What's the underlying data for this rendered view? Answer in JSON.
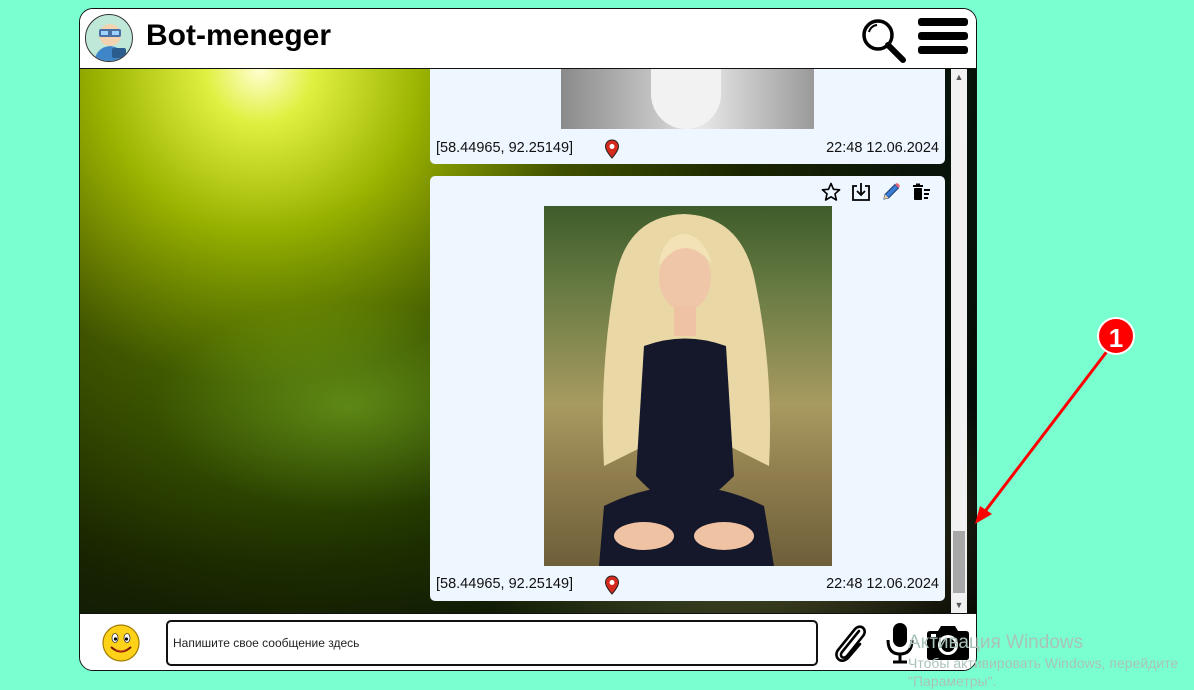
{
  "header": {
    "title": "Bot-meneger"
  },
  "messages": [
    {
      "coords": "[58.44965, 92.25149]",
      "time": "22:48 12.06.2024"
    },
    {
      "coords": "[58.44965, 92.25149]",
      "time": "22:48 12.06.2024"
    }
  ],
  "composer": {
    "placeholder": "Напишите свое сообщение здесь"
  },
  "watermark": {
    "line1": "Активация Windows",
    "line2": "Чтобы активировать Windows, перейдите",
    "line3": "\"Параметры\"."
  },
  "annotation": {
    "marker_label": "1",
    "color": "#ff0000"
  },
  "colors": {
    "page_background": "#7affd0",
    "bubble_background": "#eef6ff",
    "pin": "#d42b1e"
  },
  "icons": [
    "bot-avatar-icon",
    "search-icon",
    "menu-icon",
    "star-icon",
    "download-icon",
    "pencil-icon",
    "delete-icon",
    "location-pin-icon",
    "emoji-icon",
    "paperclip-icon",
    "microphone-icon",
    "camera-icon"
  ]
}
